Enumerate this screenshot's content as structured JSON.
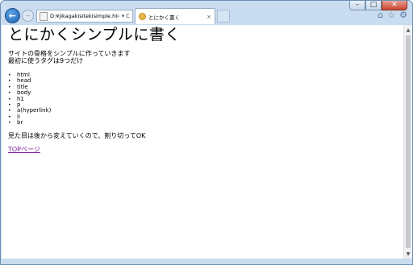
{
  "browser": {
    "address_url": "D:¥jikagakisitekisimple.html",
    "address_tools": [
      "⌕",
      "▾",
      "C"
    ],
    "tab_title": "とにかく書く",
    "tab_close": "×",
    "caption": {
      "minimize": "–",
      "maximize": "□",
      "close": "✕"
    },
    "toolbar_icons": [
      "home-icon",
      "star-icon",
      "gear-icon"
    ]
  },
  "page": {
    "heading": "とにかくシンプルに書く",
    "intro_line1": "サイトの骨格をシンプルに作っていきます",
    "intro_line2": "最初に使うタグは9つだけ",
    "tags": [
      "html",
      "head",
      "title",
      "body",
      "h1",
      "p",
      "a(hyperlink)",
      "li",
      "br"
    ],
    "note": "見た目は後から変えていくので、割り切ってOK",
    "top_link": "TOPページ"
  },
  "colors": {
    "visited_link": "#7c1da0",
    "frame": "#c9dcf0",
    "back_button": "#1c5fb0"
  }
}
